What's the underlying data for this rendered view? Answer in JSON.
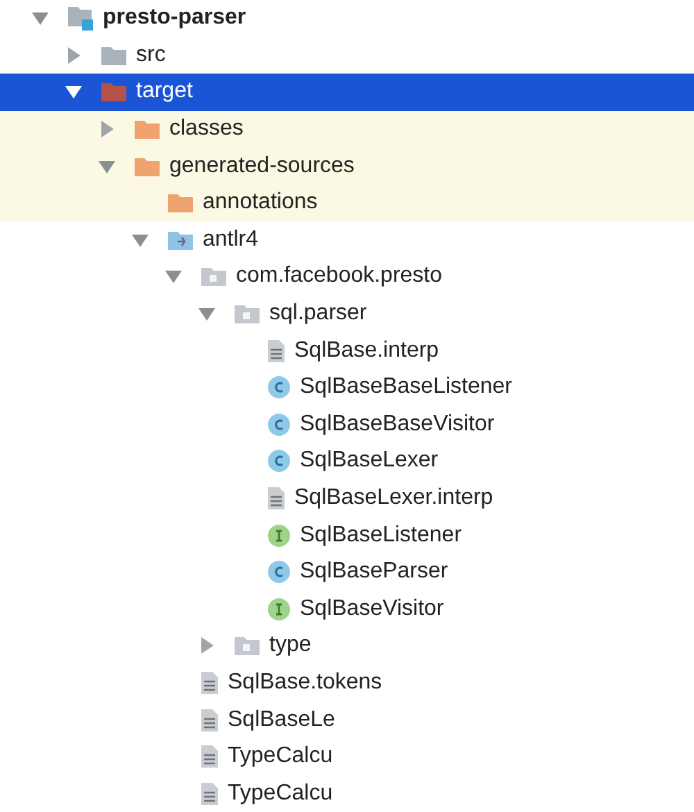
{
  "tree": [
    {
      "label": "presto-parser",
      "kind": "module",
      "expanded": true,
      "selected": false,
      "highlighted": false,
      "children": [
        {
          "label": "src",
          "kind": "folder",
          "expanded": false,
          "selected": false,
          "highlighted": false
        },
        {
          "label": "target",
          "kind": "excluded-folder",
          "expanded": true,
          "selected": true,
          "children": [
            {
              "label": "classes",
              "kind": "generated-folder",
              "expanded": false,
              "selected": false,
              "highlighted": true
            },
            {
              "label": "generated-sources",
              "kind": "generated-folder",
              "expanded": true,
              "selected": false,
              "highlighted": true,
              "children": [
                {
                  "label": "annotations",
                  "kind": "generated-folder",
                  "selected": false,
                  "highlighted": true
                },
                {
                  "label": "antlr4",
                  "kind": "source-root",
                  "expanded": true,
                  "selected": false,
                  "highlighted": false,
                  "children": [
                    {
                      "label": "com.facebook.presto",
                      "kind": "package",
                      "expanded": true,
                      "selected": false,
                      "highlighted": false,
                      "children": [
                        {
                          "label": "sql.parser",
                          "kind": "package",
                          "expanded": true,
                          "selected": false,
                          "highlighted": false,
                          "children": [
                            {
                              "label": "SqlBase.interp",
                              "kind": "text-file",
                              "selected": false,
                              "highlighted": false
                            },
                            {
                              "label": "SqlBaseBaseListener",
                              "kind": "class",
                              "selected": false,
                              "highlighted": false
                            },
                            {
                              "label": "SqlBaseBaseVisitor",
                              "kind": "class",
                              "selected": false,
                              "highlighted": false
                            },
                            {
                              "label": "SqlBaseLexer",
                              "kind": "class",
                              "selected": false,
                              "highlighted": false
                            },
                            {
                              "label": "SqlBaseLexer.interp",
                              "kind": "text-file",
                              "selected": false,
                              "highlighted": false
                            },
                            {
                              "label": "SqlBaseListener",
                              "kind": "interface",
                              "selected": false,
                              "highlighted": false
                            },
                            {
                              "label": "SqlBaseParser",
                              "kind": "class",
                              "selected": false,
                              "highlighted": false
                            },
                            {
                              "label": "SqlBaseVisitor",
                              "kind": "interface",
                              "selected": false,
                              "highlighted": false
                            }
                          ]
                        },
                        {
                          "label": "type",
                          "kind": "package",
                          "expanded": false,
                          "selected": false,
                          "highlighted": false
                        }
                      ]
                    },
                    {
                      "label": "SqlBase.tokens",
                      "kind": "text-file",
                      "selected": false,
                      "highlighted": false
                    },
                    {
                      "label": "SqlBaseLe",
                      "kind": "text-file",
                      "selected": false,
                      "highlighted": false
                    },
                    {
                      "label": "TypeCalcu",
                      "kind": "text-file",
                      "selected": false,
                      "highlighted": false
                    },
                    {
                      "label": "TypeCalcu",
                      "kind": "text-file",
                      "selected": false,
                      "highlighted": false
                    }
                  ]
                }
              ]
            }
          ]
        }
      ]
    }
  ]
}
